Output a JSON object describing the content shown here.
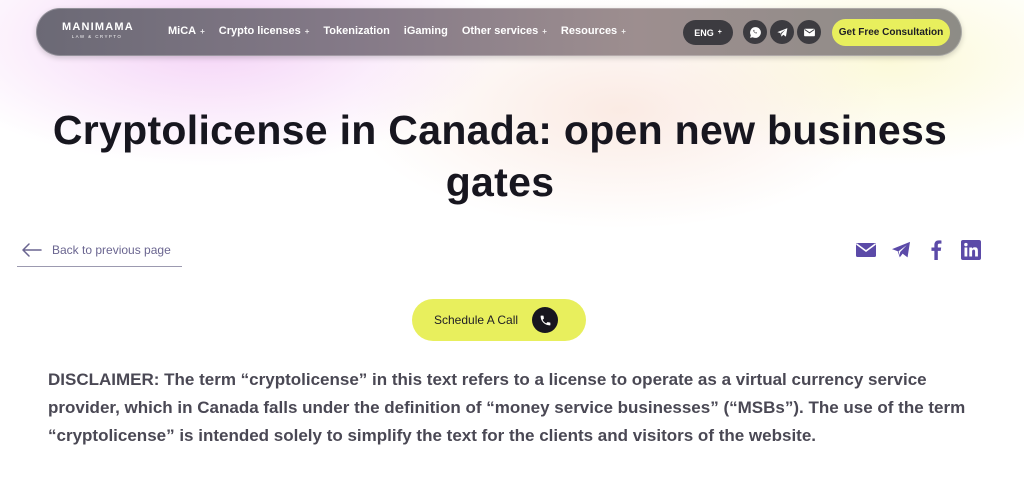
{
  "logo": {
    "name": "MANIMAMA",
    "tagline": "LAW & CRYPTO"
  },
  "nav": {
    "items": [
      {
        "label": "MiCA",
        "has_dropdown": true
      },
      {
        "label": "Crypto licenses",
        "has_dropdown": true
      },
      {
        "label": "Tokenization",
        "has_dropdown": false
      },
      {
        "label": "iGaming",
        "has_dropdown": false
      },
      {
        "label": "Other services",
        "has_dropdown": true
      },
      {
        "label": "Resources",
        "has_dropdown": true
      }
    ],
    "dropdown_marker": "+",
    "language": "ENG",
    "contact_icons": [
      "whatsapp-icon",
      "telegram-icon",
      "mail-icon"
    ],
    "cta_label": "Get Free Consultation"
  },
  "page": {
    "title": "Cryptolicense in Canada: open new business gates",
    "back_label": "Back to previous page",
    "share_icons": [
      "mail-icon",
      "telegram-icon",
      "facebook-icon",
      "linkedin-icon"
    ],
    "schedule_label": "Schedule A Call",
    "disclaimer": "DISCLAIMER: The term “cryptolicense” in this text refers to a license to operate as a virtual currency service provider, which in Canada falls under the definition of “money service businesses” (“MSBs”). The use of the term “cryptolicense” is intended solely to simplify the text for the clients and visitors of the website."
  },
  "colors": {
    "accent_yellow": "#e8ef5d",
    "share_purple": "#5b4aa8",
    "title_dark": "#17161f",
    "link_purple": "#6a6590"
  }
}
